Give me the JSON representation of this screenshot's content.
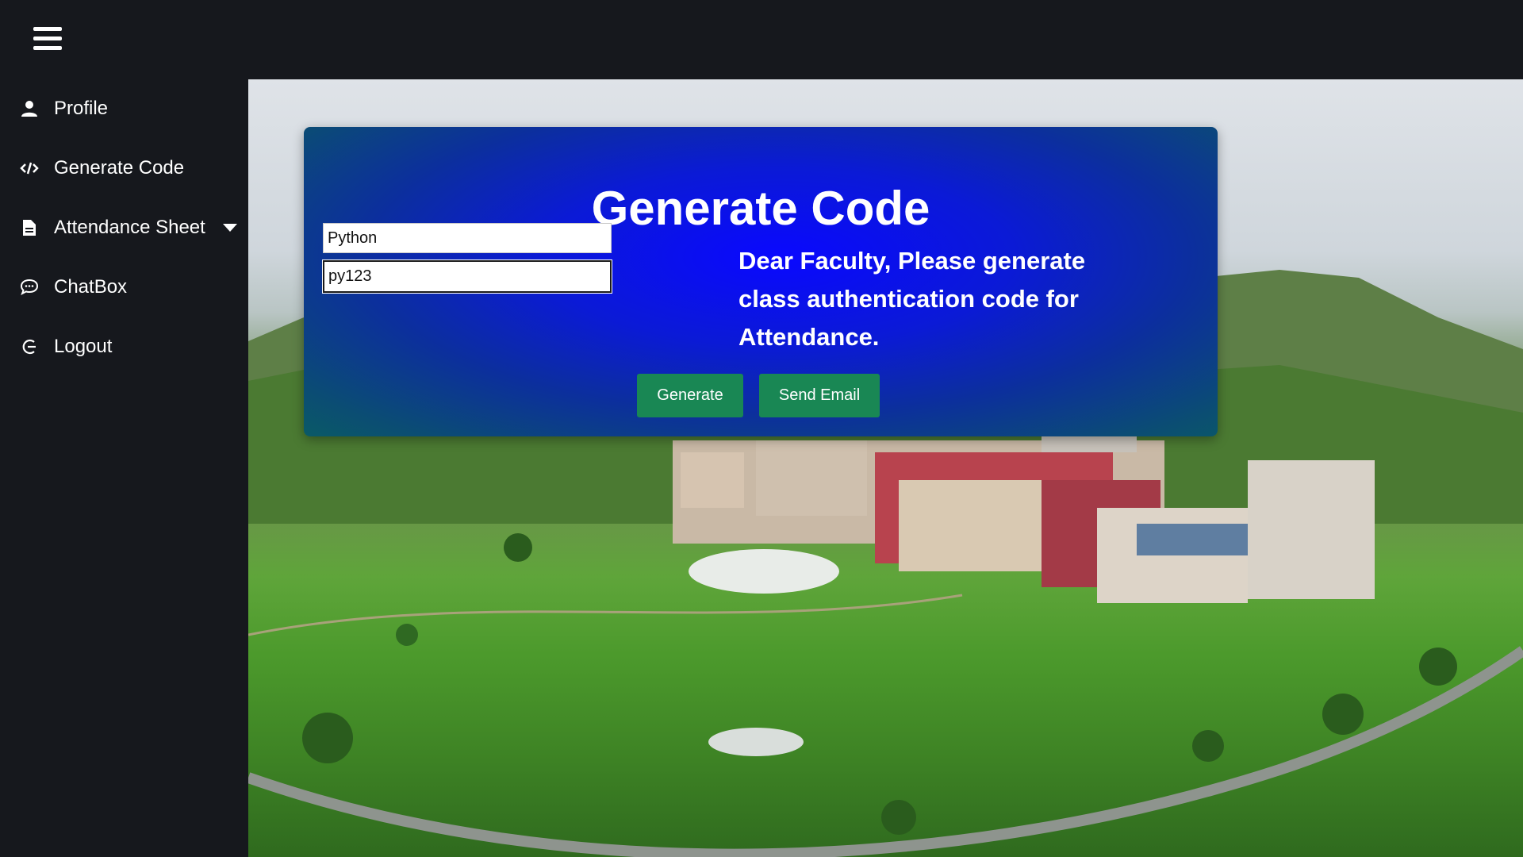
{
  "sidebar": {
    "items": [
      {
        "label": "Profile",
        "icon": "user-icon"
      },
      {
        "label": "Generate Code",
        "icon": "code-icon"
      },
      {
        "label": "Attendance Sheet",
        "icon": "file-icon",
        "dropdown": true
      },
      {
        "label": "ChatBox",
        "icon": "chat-icon"
      },
      {
        "label": "Logout",
        "icon": "logout-icon"
      }
    ]
  },
  "card": {
    "title": "Generate Code",
    "subject_value": "Python",
    "code_value": "py123",
    "message": "Dear Faculty, Please generate class authentication code for Attendance.",
    "generate_label": "Generate",
    "send_email_label": "Send Email"
  },
  "colors": {
    "sidebar_bg": "#16181d",
    "button_green": "#198754",
    "card_blue": "#0a08ff",
    "text_white": "#ffffff"
  }
}
